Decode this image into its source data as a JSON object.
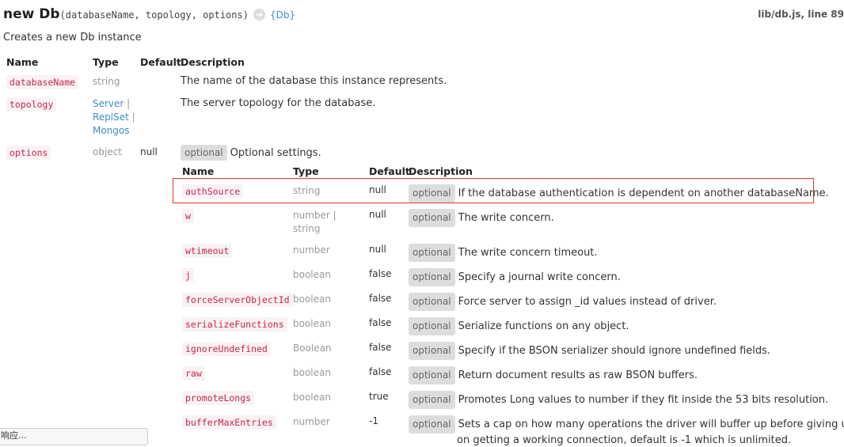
{
  "header": {
    "name": "new Db",
    "signature": "(databaseName, topology, options)",
    "arrow_icon": "arrow-right-circle-icon",
    "returns": "{Db}",
    "source": "lib/db.js, line 89"
  },
  "description": "Creates a new Db instance",
  "columns": {
    "name": "Name",
    "type": "Type",
    "default": "Default",
    "description": "Description"
  },
  "params": [
    {
      "name": "databaseName",
      "type": "string",
      "default": "",
      "description": "The name of the database this instance represents."
    },
    {
      "name": "topology",
      "types": [
        "Server",
        "ReplSet",
        "Mongos"
      ],
      "default": "",
      "description": "The server topology for the database."
    },
    {
      "name": "options",
      "type": "object",
      "default": "null",
      "optional": "optional",
      "description": "Optional settings."
    }
  ],
  "options": [
    {
      "name": "authSource",
      "type": "string",
      "default": "null",
      "optional": "optional",
      "description": "If the database authentication is dependent on another databaseName."
    },
    {
      "name": "w",
      "type": "number",
      "type2": "string",
      "default": "null",
      "optional": "optional",
      "description": "The write concern."
    },
    {
      "name": "wtimeout",
      "type": "number",
      "default": "null",
      "optional": "optional",
      "description": "The write concern timeout."
    },
    {
      "name": "j",
      "type": "boolean",
      "default": "false",
      "optional": "optional",
      "description": "Specify a journal write concern."
    },
    {
      "name": "forceServerObjectId",
      "type": "boolean",
      "default": "false",
      "optional": "optional",
      "description": "Force server to assign _id values instead of driver."
    },
    {
      "name": "serializeFunctions",
      "type": "boolean",
      "default": "false",
      "optional": "optional",
      "description": "Serialize functions on any object."
    },
    {
      "name": "ignoreUndefined",
      "type": "Boolean",
      "default": "false",
      "optional": "optional",
      "description": "Specify if the BSON serializer should ignore undefined fields."
    },
    {
      "name": "raw",
      "type": "boolean",
      "default": "false",
      "optional": "optional",
      "description": "Return document results as raw BSON buffers."
    },
    {
      "name": "promoteLongs",
      "type": "boolean",
      "default": "true",
      "optional": "optional",
      "description": "Promotes Long values to number if they fit inside the 53 bits resolution."
    },
    {
      "name": "bufferMaxEntries",
      "type": "number",
      "default": "-1",
      "optional": "optional",
      "description": "Sets a cap on how many operations the driver will buffer up before giving up",
      "description2": "on getting a working connection, default is -1 which is unlimited."
    }
  ],
  "status_text": "响应..."
}
